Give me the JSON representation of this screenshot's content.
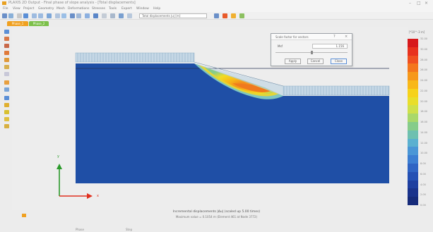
{
  "window": {
    "title": "PLAXIS 2D Output - Final phase of slope analysis - [Total displacements]",
    "controls": [
      "–",
      "□",
      "×"
    ]
  },
  "menu": [
    "File",
    "View",
    "Project",
    "Geometry",
    "Mesh",
    "Deformations",
    "Stresses",
    "Tools",
    "Expert",
    "Window",
    "Help"
  ],
  "toolbar": {
    "result_select": "Total displacements |u| [m]"
  },
  "tabs": [
    {
      "label": "Phase_1",
      "color": "#f0a020"
    },
    {
      "label": "Phase_2",
      "color": "#7cc04a"
    }
  ],
  "dialog": {
    "title": "Scale factor for vectors",
    "rows": [
      {
        "label": "Msf",
        "value": "1.156"
      },
      {
        "label": "",
        "value": ""
      }
    ],
    "buttons": [
      "Apply",
      "Cancel",
      "Close"
    ]
  },
  "legend": {
    "unit": "[*10^-3 m]",
    "colors": [
      "#d7191c",
      "#e8321e",
      "#f05020",
      "#f4761c",
      "#f6981a",
      "#f8b818",
      "#f6d21a",
      "#e9de2a",
      "#cfe04a",
      "#a9d86a",
      "#86cc8a",
      "#6ec0b0",
      "#5ab0d0",
      "#4a96d6",
      "#3c7ed2",
      "#2f64c4",
      "#2450b4",
      "#1e3fa0",
      "#1a338c",
      "#162b7a"
    ],
    "labels": [
      "32.00",
      "30.00",
      "28.00",
      "26.00",
      "24.00",
      "22.00",
      "20.00",
      "18.00",
      "16.00",
      "14.00",
      "12.00",
      "10.00",
      "8.00",
      "6.00",
      "4.00",
      "2.00",
      "0.00"
    ]
  },
  "axes": {
    "x": "x",
    "y": "y"
  },
  "status": {
    "main": "Incremental displacements |Δu| (scaled up 5.00 times)",
    "sub": "Maximum value = 0.1054 m (Element 461 at Node 3772)",
    "footer_left": "Phase",
    "footer_right": "Step"
  }
}
